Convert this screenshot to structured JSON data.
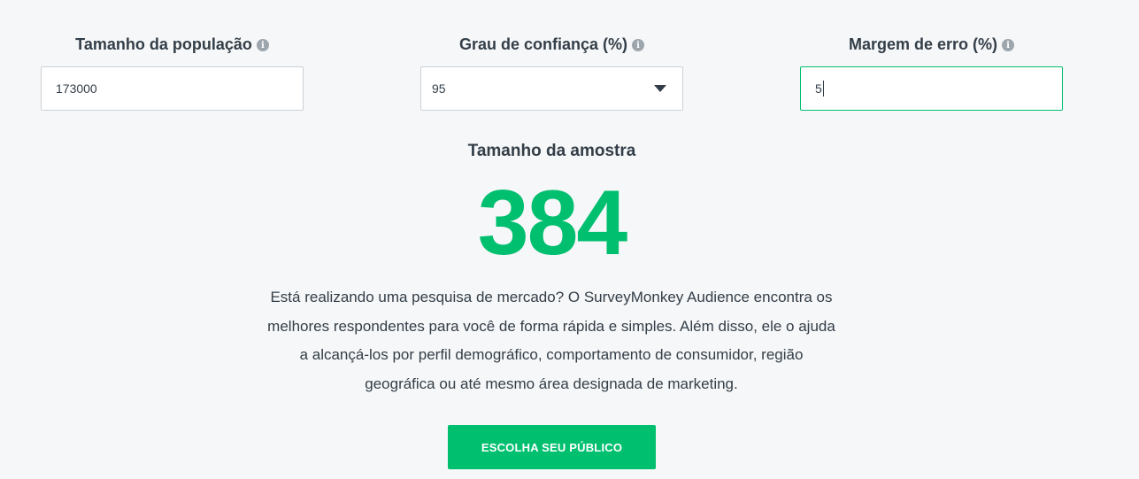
{
  "fields": {
    "population": {
      "label": "Tamanho da população",
      "value": "173000"
    },
    "confidence": {
      "label": "Grau de confiança (%)",
      "value": "95"
    },
    "margin": {
      "label": "Margem de erro (%)",
      "value": "5"
    },
    "info_glyph": "i"
  },
  "result": {
    "label": "Tamanho da amostra",
    "value": "384"
  },
  "description": "Está realizando uma pesquisa de mercado? O SurveyMonkey Audience encontra os melhores respondentes para você de forma rápida e simples. Além disso, ele o ajuda a alcançá-los por perfil demográfico, comportamento de consumidor, região geográfica ou até mesmo área designada de marketing.",
  "cta": {
    "label": "ESCOLHA SEU PÚBLICO"
  },
  "colors": {
    "accent": "#00bf6f",
    "text": "#333e48",
    "background": "#f6f7f8",
    "border": "#ccd1d5",
    "info_icon": "#9da5ad"
  },
  "icons": {
    "info": "info-icon",
    "dropdown": "caret-down-icon"
  }
}
